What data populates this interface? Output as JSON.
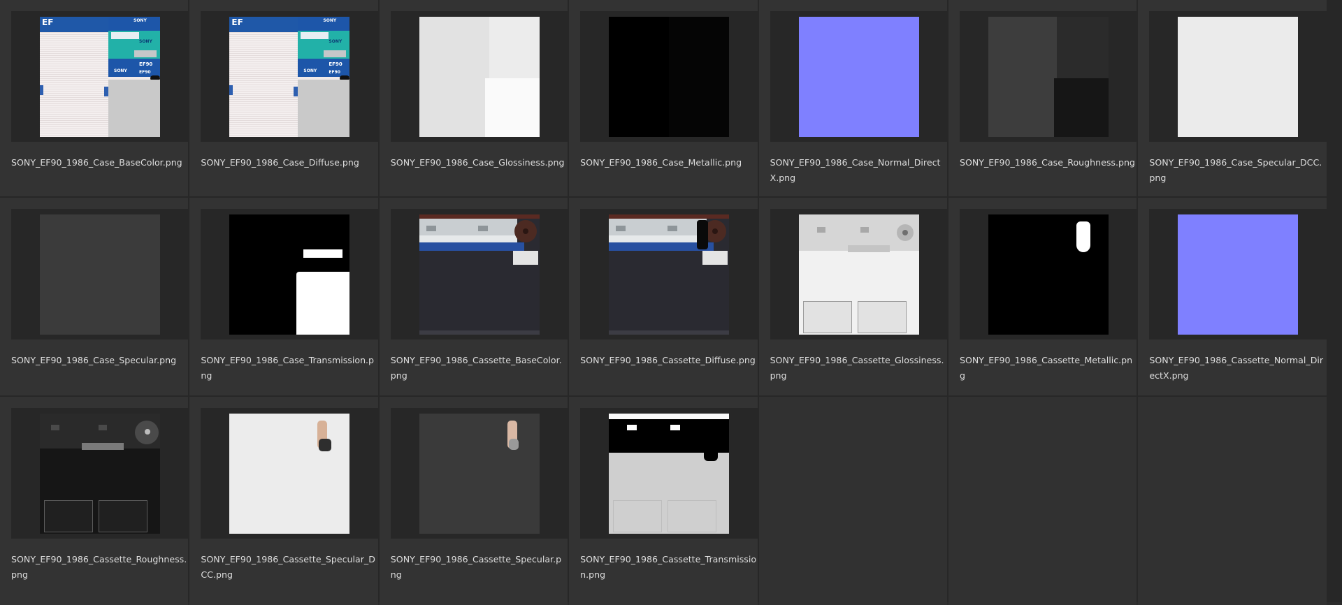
{
  "files": [
    {
      "name": "SONY_EF90_1986_Case_BaseColor.png",
      "kind": "case-basecolor"
    },
    {
      "name": "SONY_EF90_1986_Case_Diffuse.png",
      "kind": "case-basecolor"
    },
    {
      "name": "SONY_EF90_1986_Case_Glossiness.png",
      "kind": "case-gloss"
    },
    {
      "name": "SONY_EF90_1986_Case_Metallic.png",
      "kind": "black"
    },
    {
      "name": "SONY_EF90_1986_Case_Normal_DirectX.png",
      "kind": "normal"
    },
    {
      "name": "SONY_EF90_1986_Case_Roughness.png",
      "kind": "case-rough"
    },
    {
      "name": "SONY_EF90_1986_Case_Specular_DCC.png",
      "kind": "white"
    },
    {
      "name": "SONY_EF90_1986_Case_Specular.png",
      "kind": "darkgrey"
    },
    {
      "name": "SONY_EF90_1986_Case_Transmission.png",
      "kind": "case-trans"
    },
    {
      "name": "SONY_EF90_1986_Cassette_BaseColor.png",
      "kind": "cassette-basecolor"
    },
    {
      "name": "SONY_EF90_1986_Cassette_Diffuse.png",
      "kind": "cassette-diffuse"
    },
    {
      "name": "SONY_EF90_1986_Cassette_Glossiness.png",
      "kind": "cassette-gloss"
    },
    {
      "name": "SONY_EF90_1986_Cassette_Metallic.png",
      "kind": "cassette-metal"
    },
    {
      "name": "SONY_EF90_1986_Cassette_Normal_DirectX.png",
      "kind": "normal"
    },
    {
      "name": "SONY_EF90_1986_Cassette_Roughness.png",
      "kind": "cassette-rough"
    },
    {
      "name": "SONY_EF90_1986_Cassette_Specular_DCC.png",
      "kind": "cassette-specdcc"
    },
    {
      "name": "SONY_EF90_1986_Cassette_Specular.png",
      "kind": "cassette-spec"
    },
    {
      "name": "SONY_EF90_1986_Cassette_Transmission.png",
      "kind": "cassette-trans"
    }
  ],
  "thumb_text": {
    "ef": "EF",
    "sony": "SONY",
    "ef90": "EF90"
  },
  "colors": {
    "normal_map": "#7f80ff",
    "tile_bg": "#333333",
    "frame_bg": "#272727",
    "label_text": "#dedede"
  }
}
